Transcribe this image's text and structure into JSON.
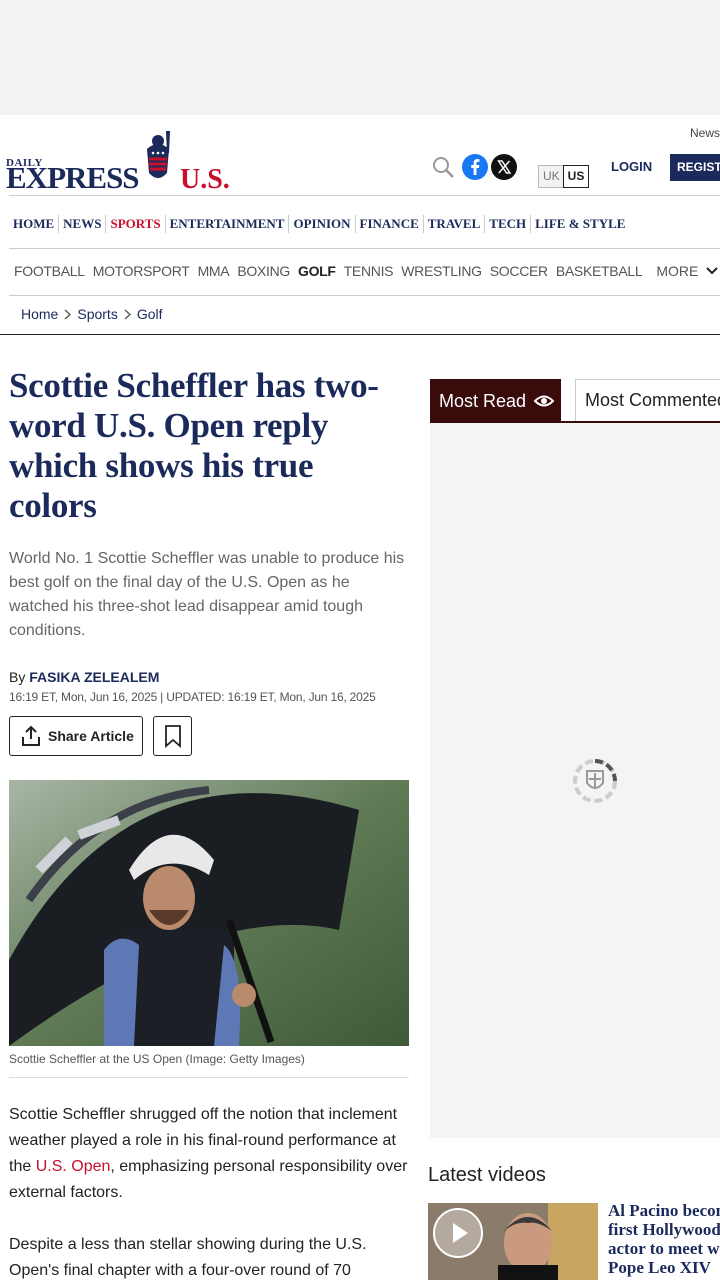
{
  "header": {
    "logo_daily": "DAILY",
    "logo_express": "EXPRESS",
    "logo_us": "U.S.",
    "news_link": "News",
    "edition": {
      "uk": "UK",
      "us": "US"
    },
    "login": "LOGIN",
    "register": "REGISTER"
  },
  "main_nav": [
    {
      "label": "HOME"
    },
    {
      "label": "NEWS"
    },
    {
      "label": "SPORTS"
    },
    {
      "label": "ENTERTAINMENT"
    },
    {
      "label": "OPINION"
    },
    {
      "label": "FINANCE"
    },
    {
      "label": "TRAVEL"
    },
    {
      "label": "TECH"
    },
    {
      "label": "LIFE & STYLE"
    }
  ],
  "sub_nav": [
    {
      "label": "FOOTBALL"
    },
    {
      "label": "MOTORSPORT"
    },
    {
      "label": "MMA"
    },
    {
      "label": "BOXING"
    },
    {
      "label": "GOLF"
    },
    {
      "label": "TENNIS"
    },
    {
      "label": "WRESTLING"
    },
    {
      "label": "SOCCER"
    },
    {
      "label": "BASKETBALL"
    }
  ],
  "sub_nav_more": "MORE",
  "breadcrumb": [
    "Home",
    "Sports",
    "Golf"
  ],
  "article": {
    "headline": "Scottie Scheffler has two-word U.S. Open reply which shows his true colors",
    "standfirst": "World No. 1 Scottie Scheffler was unable to produce his best golf on the final day of the U.S. Open as he watched his three-shot lead disappear amid tough conditions.",
    "by": "By",
    "author": "FASIKA ZELEALEM",
    "dateline": "16:19 ET, Mon, Jun 16, 2025 | UPDATED: 16:19 ET, Mon, Jun 16, 2025",
    "share_label": "Share Article",
    "caption": "Scottie Scheffler at the US Open (Image: Getty Images)",
    "p1_before": "Scottie Scheffler shrugged off the notion that inclement weather played a role in his final-round performance at the ",
    "p1_link": "U.S. Open",
    "p1_after": ", emphasizing personal responsibility over external factors.",
    "p2": "Despite a less than stellar showing during the U.S. Open's final chapter with a four-over round of 70"
  },
  "sidebar": {
    "tab_most_read": "Most Read",
    "tab_most_commented": "Most Commented",
    "latest_videos_title": "Latest videos",
    "video_title_lines": [
      "Al Pacino becomes",
      "first Hollywood",
      "actor to meet with",
      "Pope Leo XIV"
    ]
  }
}
